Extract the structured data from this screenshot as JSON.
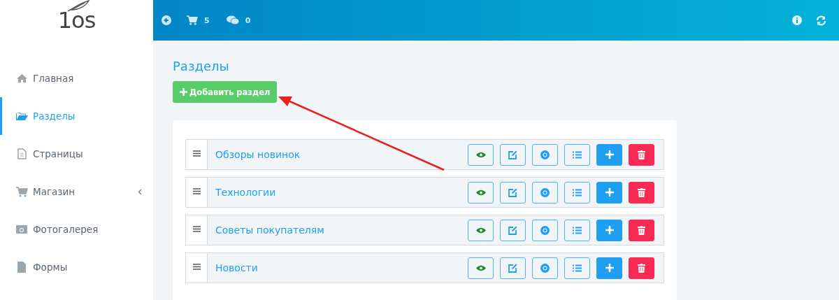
{
  "logo": {
    "text": "1os"
  },
  "header": {
    "cart_count": "5",
    "messages_count": "0"
  },
  "sidebar": {
    "items": [
      {
        "label": "Главная",
        "kind": "home",
        "selected": false,
        "expandable": false
      },
      {
        "label": "Разделы",
        "kind": "folder",
        "selected": true,
        "expandable": false
      },
      {
        "label": "Страницы",
        "kind": "page",
        "selected": false,
        "expandable": false
      },
      {
        "label": "Магазин",
        "kind": "cart",
        "selected": false,
        "expandable": true
      },
      {
        "label": "Фотогалерея",
        "kind": "photo",
        "selected": false,
        "expandable": false
      },
      {
        "label": "Формы",
        "kind": "file",
        "selected": false,
        "expandable": false
      }
    ]
  },
  "page": {
    "title": "Разделы",
    "add_button": "Добавить раздел"
  },
  "sections": [
    {
      "name": "Обзоры новинок"
    },
    {
      "name": "Технологии"
    },
    {
      "name": "Советы покупателям"
    },
    {
      "name": "Новости"
    }
  ]
}
